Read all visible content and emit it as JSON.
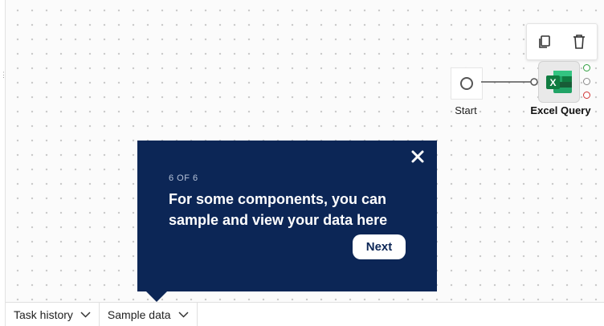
{
  "canvas": {
    "toolbar": {
      "copy_icon": "copy-icon",
      "delete_icon": "trash-icon"
    },
    "nodes": [
      {
        "label": "Start",
        "icon": "start-circle-icon"
      },
      {
        "label": "Excel Query",
        "icon": "excel-icon",
        "icon_letter": "X"
      }
    ],
    "ports": {
      "success_color": "#2e9e3e",
      "neutral_color": "#888888",
      "error_color": "#d03333"
    }
  },
  "tour": {
    "step": "6 OF 6",
    "text": "For some components, you can sample and view your data here",
    "next_label": "Next",
    "background": "#0c2656"
  },
  "bottom_tabs": [
    {
      "label": "Task history"
    },
    {
      "label": "Sample data"
    }
  ]
}
